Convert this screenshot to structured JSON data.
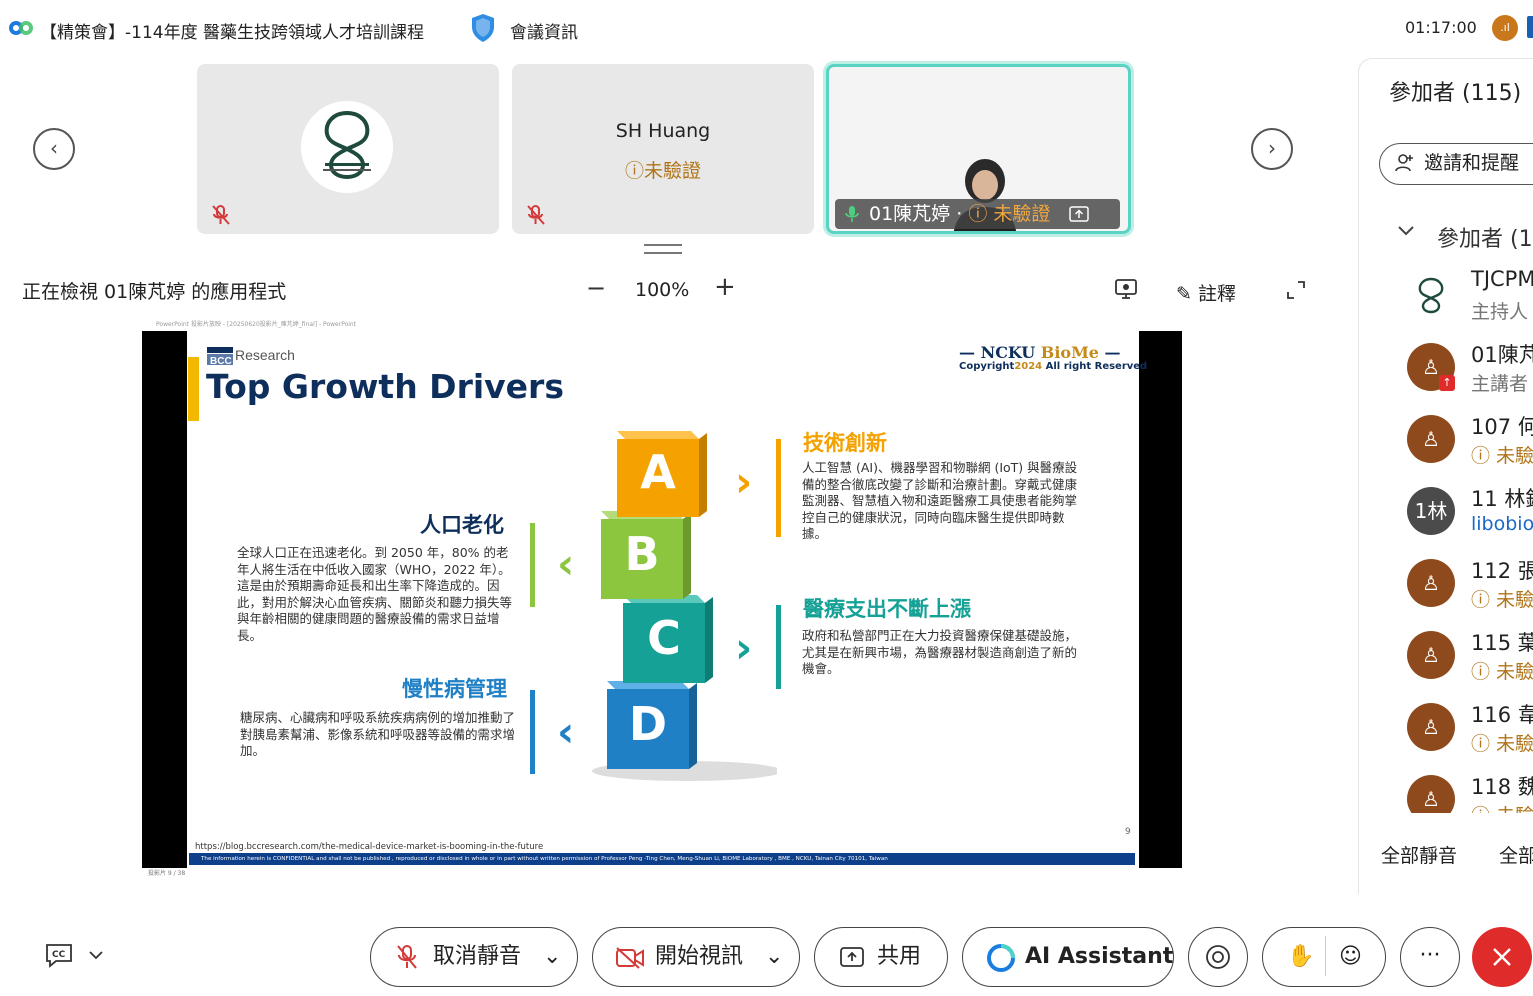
{
  "top_bar": {
    "meeting_title": "【精策會】-114年度 醫藥生技跨領域人才培訓課程",
    "meeting_info_label": "會議資訊",
    "timer": "01:17:00",
    "signal_avatar_text": ".ıl"
  },
  "video_strip": {
    "tile2": {
      "name": "SH Huang",
      "status": "未驗證"
    },
    "tile3": {
      "name": "01陳芃婷",
      "status": "未驗證"
    }
  },
  "view_bar": {
    "viewing_text": "正在檢視 01陳芃婷 的應用程式",
    "zoom_minus": "−",
    "zoom_level": "100%",
    "zoom_plus": "+",
    "annotate_label": "註釋"
  },
  "shared_window": {
    "titlebar_text": "PowerPoint 投影片放映 - [20250620投影片_陳芃婷_final] - PowerPoint",
    "statusbar_text": "投影片 9 / 38"
  },
  "slide": {
    "logo_text": "Research",
    "title": "Top Growth Drivers",
    "brand_left": "— NCKU ",
    "brand_bio": "BioMe",
    "brand_right": " —",
    "copyright_prefix": "Copyright",
    "copyright_year": "2024",
    "copyright_suffix": " All right Reserved",
    "blocks": [
      "A",
      "B",
      "C",
      "D"
    ],
    "sections": {
      "a": {
        "heading": "技術創新",
        "body": "人工智慧 (AI)、機器學習和物聯網 (IoT) 與醫療設備的整合徹底改變了診斷和治療計劃。穿戴式健康監測器、智慧植入物和遠距醫療工具使患者能夠掌控自己的健康狀況，同時向臨床醫生提供即時數據。"
      },
      "b": {
        "heading": "人口老化",
        "body": "全球人口正在迅速老化。到 2050 年，80% 的老年人將生活在中低收入國家（WHO，2022 年）。這是由於預期壽命延長和出生率下降造成的。因此，對用於解決心血管疾病、關節炎和聽力損失等與年齡相關的健康問題的醫療設備的需求日益增長。"
      },
      "c": {
        "heading": "醫療支出不斷上漲",
        "body": "政府和私營部門正在大力投資醫療保健基礎設施，尤其是在新興市場，為醫療器材製造商創造了新的機會。"
      },
      "d": {
        "heading": "慢性病管理",
        "body": "糖尿病、心臟病和呼吸系統疾病病例的增加推動了對胰島素幫浦、影像系統和呼吸器等設備的需求增加。"
      }
    },
    "source_url": "https://blog.bccresearch.com/the-medical-device-market-is-booming-in-the-future",
    "page_number": "9",
    "footer_text": "The information herein is CONFIDENTIAL and shall not be published , reproduced or disclosed in whole or in part without written permission of Professor  Peng -Ting Chen, Meng-Shuan Li, BiOME Laboratory , BME , NCKU, Tainan City 70101, Taiwan"
  },
  "panel": {
    "title": "參加者 (115)",
    "invite_label": "邀請和提醒",
    "section_label": "參加者 (1",
    "participants": [
      {
        "name": "TJCPM",
        "sub": "主持人"
      },
      {
        "name": "01陳芃",
        "sub": "主講者"
      },
      {
        "name": "107 何",
        "sub": "未驗"
      },
      {
        "name": "11 林銘",
        "sub": "libobio",
        "avatar": "1林"
      },
      {
        "name": "112 張",
        "sub": "未驗"
      },
      {
        "name": "115 葉",
        "sub": "未驗"
      },
      {
        "name": "116 韋",
        "sub": "未驗"
      },
      {
        "name": "118 魏",
        "sub": "未驗"
      }
    ],
    "mute_all": "全部靜音",
    "unmute_all": "全部"
  },
  "toolbar": {
    "unmute_label": "取消靜音",
    "start_video_label": "開始視訊",
    "share_label": "共用",
    "ai_label": "AI Assistant",
    "more_label": "···"
  },
  "colors": {
    "accent_teal": "#58d3c4",
    "end_red": "#e02b2b",
    "slide_navy": "#0e2f5c",
    "block_a": "#f5a100",
    "block_b": "#8cc63e",
    "block_c": "#15a195",
    "block_d": "#1f80c5"
  }
}
